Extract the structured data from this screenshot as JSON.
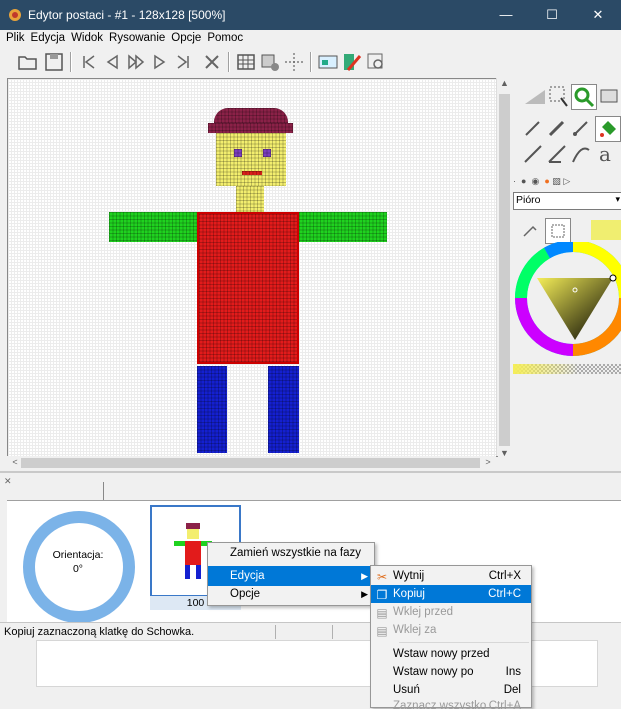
{
  "window": {
    "title": "Edytor postaci - #1 - 128x128 [500%]",
    "minimize": "—",
    "maximize": "☐",
    "close": "✕"
  },
  "menubar": [
    "Plik",
    "Edycja",
    "Widok",
    "Rysowanie",
    "Opcje",
    "Pomoc"
  ],
  "right_panel": {
    "tool_select_value": "Pióro",
    "swatch_color": "#f0ee70"
  },
  "canvas": {
    "figure_colors": {
      "hat": "#8b2148",
      "skin": "#f3ee6e",
      "eyes": "#7b3fbf",
      "mouth": "#d8201a",
      "arms": "#1fd21f",
      "torso": "#e21b1b",
      "legs": "#1420d0"
    }
  },
  "frames": {
    "orientation_label": "Orientacja:",
    "orientation_value": "0°",
    "frame_number": "100"
  },
  "status_text": "Kopiuj zaznaczoną klatkę do Schowka.",
  "context_menu": {
    "items": [
      {
        "label": "Zamień wszystkie na fazy"
      },
      {
        "label": "Edycja",
        "submenu": true,
        "highlighted": true
      },
      {
        "label": "Opcje",
        "submenu": true
      }
    ]
  },
  "edit_submenu": {
    "items": [
      {
        "label": "Wytnij",
        "shortcut": "Ctrl+X",
        "icon": "scissors-icon"
      },
      {
        "label": "Kopiuj",
        "shortcut": "Ctrl+C",
        "icon": "copy-icon",
        "highlighted": true
      },
      {
        "label": "Wklej przed",
        "shortcut": "",
        "icon": "paste-before-icon",
        "disabled": true
      },
      {
        "label": "Wklej za",
        "shortcut": "",
        "icon": "paste-after-icon",
        "disabled": true
      },
      {
        "label": "Wstaw nowy przed",
        "shortcut": ""
      },
      {
        "label": "Wstaw nowy po",
        "shortcut": "Ins"
      },
      {
        "label": "Usuń",
        "shortcut": "Del"
      },
      {
        "label": "Zaznacz wszystko",
        "shortcut": "Ctrl+A",
        "disabled": true
      }
    ]
  }
}
